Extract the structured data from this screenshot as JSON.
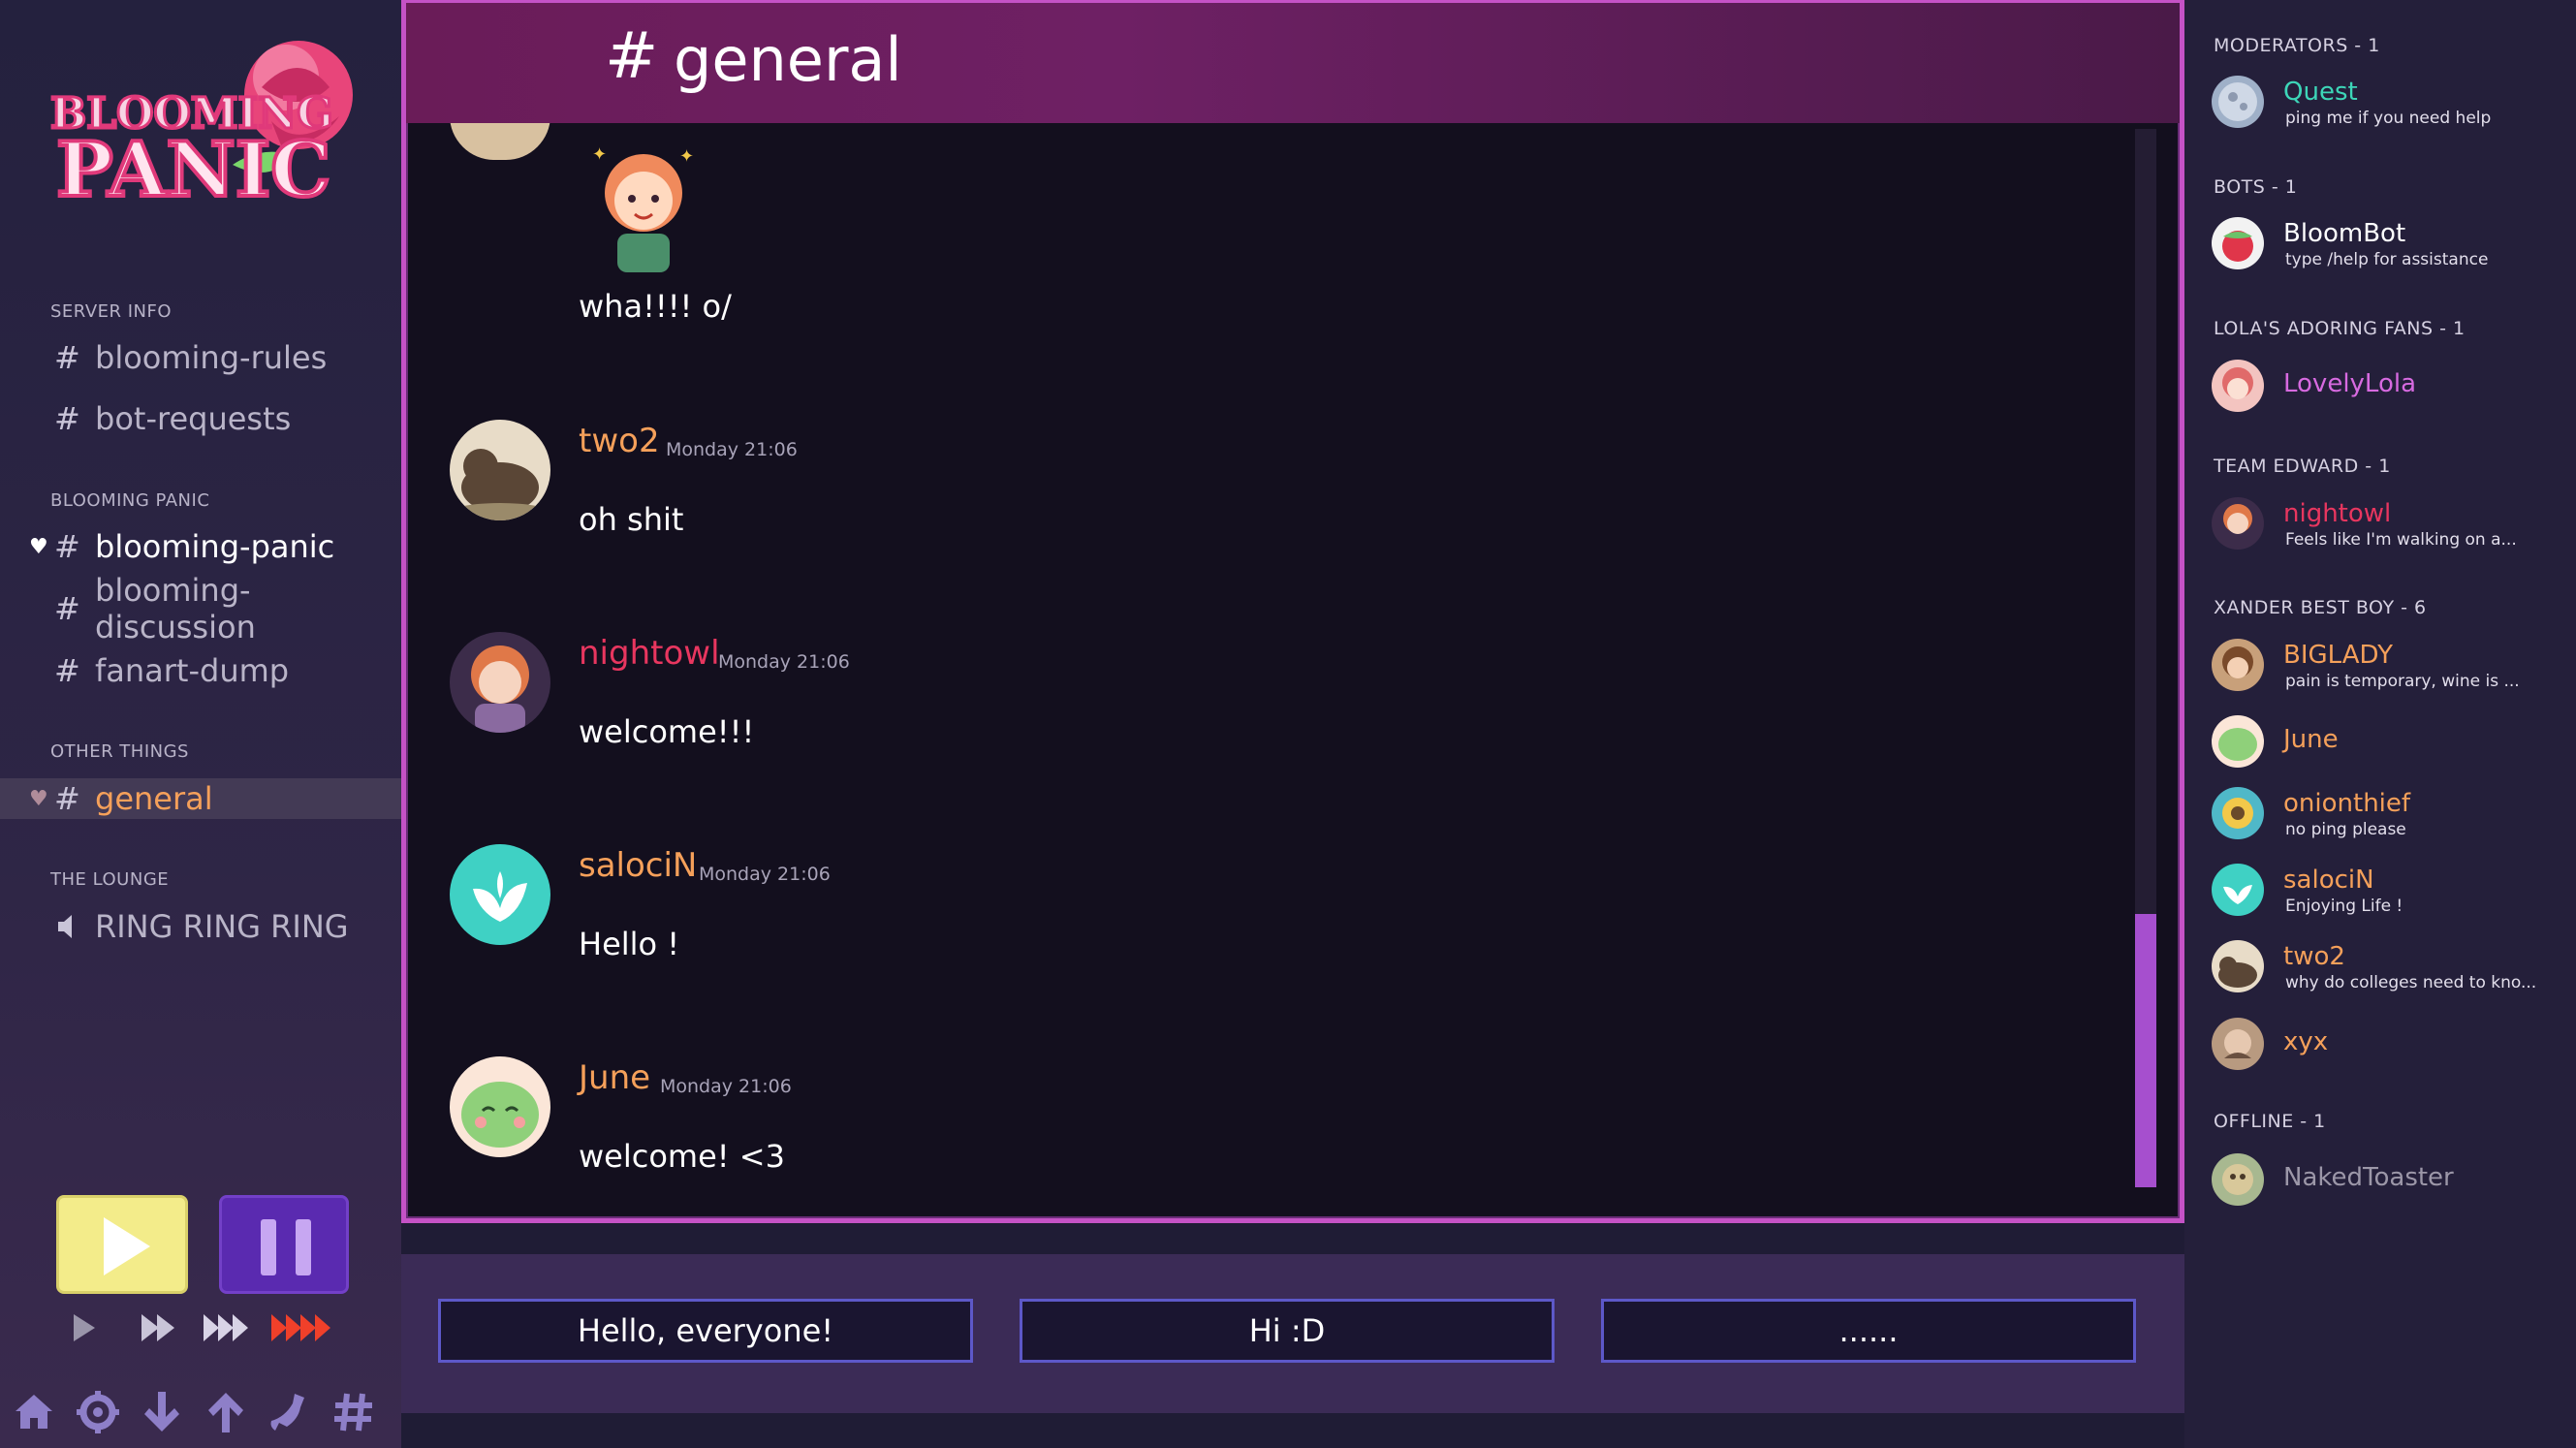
{
  "logo": {
    "line1": "BLOOMING",
    "line2": "PANIC"
  },
  "sidebar": {
    "sections": [
      {
        "label": "SERVER INFO"
      },
      {
        "label": "BLOOMING PANIC"
      },
      {
        "label": "OTHER THINGS"
      },
      {
        "label": "THE LOUNGE"
      }
    ],
    "channels": [
      {
        "hash": "#",
        "label": "blooming-rules"
      },
      {
        "hash": "#",
        "label": "bot-requests"
      },
      {
        "hash": "#",
        "label": "blooming-panic",
        "heart": "♥"
      },
      {
        "hash": "#",
        "label": "blooming-discussion"
      },
      {
        "hash": "#",
        "label": "fanart-dump"
      },
      {
        "hash": "#",
        "label": "general",
        "heart": "♥"
      },
      {
        "label": "RING RING RING",
        "icon": "speaker-icon"
      }
    ]
  },
  "controls": {
    "play_icon": "play-icon",
    "pause_icon": "pause-icon",
    "speeds": [
      "speed-1x-icon",
      "speed-2x-icon",
      "speed-3x-icon",
      "speed-4x-icon"
    ],
    "toolbar": [
      "home-icon",
      "gear-icon",
      "arrow-down-icon",
      "arrow-up-icon",
      "phone-icon",
      "hash-icon"
    ],
    "accent_play": "#f3ec8a",
    "accent_pause": "#5a2ab0",
    "accent_fast": "#f0402a"
  },
  "chat": {
    "hash": "#",
    "channel_title": "general",
    "messages": [
      {
        "author": "",
        "timestamp": "",
        "text": "wha!!!! o/",
        "has_image": true
      },
      {
        "author": "two2",
        "timestamp": "Monday 21:06",
        "text": "oh shit",
        "color": "#f5a05a"
      },
      {
        "author": "nightowl",
        "timestamp": "Monday 21:06",
        "text": "welcome!!!",
        "color": "#e8365f"
      },
      {
        "author": "salociN",
        "timestamp": "Monday 21:06",
        "text": "Hello !",
        "color": "#f5a05a"
      },
      {
        "author": "June",
        "timestamp": "Monday 21:06",
        "text": "welcome! <3",
        "color": "#f5a05a"
      }
    ]
  },
  "responses": [
    {
      "label": "Hello, everyone!"
    },
    {
      "label": "Hi :D"
    },
    {
      "label": "......"
    }
  ],
  "members": {
    "groups": [
      {
        "label": "MODERATORS - 1"
      },
      {
        "label": "BOTS - 1"
      },
      {
        "label": "LOLA'S ADORING FANS - 1"
      },
      {
        "label": "TEAM EDWARD - 1"
      },
      {
        "label": "XANDER BEST BOY - 6"
      },
      {
        "label": "OFFLINE - 1"
      }
    ],
    "list": [
      {
        "name": "Quest",
        "status": "ping me if you need help",
        "color": "#3dd6b8"
      },
      {
        "name": "BloomBot",
        "status": "type /help for assistance",
        "color": "#ffffff"
      },
      {
        "name": "LovelyLola",
        "status": "",
        "color": "#d76ae0"
      },
      {
        "name": "nightowl",
        "status": "Feels like I'm walking on a...",
        "color": "#e8365f"
      },
      {
        "name": "BIGLADY",
        "status": "pain is temporary, wine is ...",
        "color": "#f5a05a"
      },
      {
        "name": "June",
        "status": "",
        "color": "#f5a05a"
      },
      {
        "name": "onionthief",
        "status": "no ping please",
        "color": "#f5a05a"
      },
      {
        "name": "salociN",
        "status": "Enjoying Life !",
        "color": "#f5a05a"
      },
      {
        "name": "two2",
        "status": "why do colleges need to kno...",
        "color": "#f5a05a"
      },
      {
        "name": "xyx",
        "status": "",
        "color": "#f5a05a"
      },
      {
        "name": "NakedToaster",
        "status": "",
        "color": "#9c97a8"
      }
    ]
  }
}
